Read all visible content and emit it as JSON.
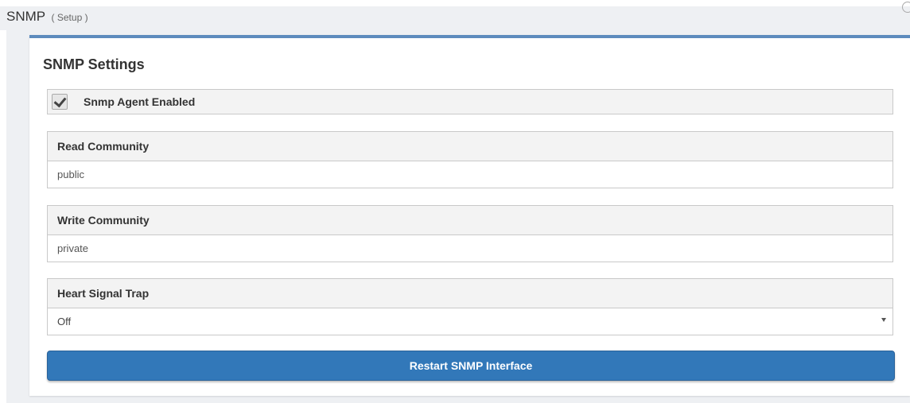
{
  "header": {
    "title": "SNMP",
    "subtitle": "( Setup )"
  },
  "panel": {
    "title": "SNMP Settings"
  },
  "snmp_agent": {
    "label": "Snmp Agent Enabled",
    "checked": true
  },
  "read_community": {
    "label": "Read Community",
    "value": "public"
  },
  "write_community": {
    "label": "Write Community",
    "value": "private"
  },
  "heart_signal_trap": {
    "label": "Heart Signal Trap",
    "selected": "Off"
  },
  "actions": {
    "restart_label": "Restart SNMP Interface"
  },
  "colors": {
    "accent": "#3278b9",
    "panel_top_border": "#5d8bbd"
  }
}
